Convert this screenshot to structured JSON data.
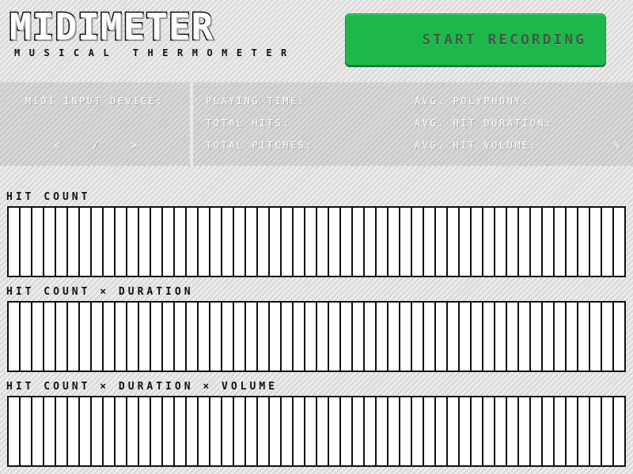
{
  "app": {
    "title": "MIDIMETER",
    "subtitle": "MUSICAL THERMOMETER"
  },
  "record_button": {
    "label": "START RECORDING",
    "color": "#1db84a"
  },
  "device": {
    "label": "MIDI INPUT DEVICE:",
    "prev_symbol": "<",
    "separator": "/",
    "next_symbol": ">"
  },
  "stats": {
    "playing_time_label": "PLAYING TIME:",
    "total_hits_label": "TOTAL HITS:",
    "total_pitches_label": "TOTAL PITCHES:",
    "avg_polyphony_label": "AVG. POLYPHONY:",
    "avg_hit_duration_label": "AVG. HIT DURATION:",
    "avg_hit_volume_label": "AVG. HIT VOLUME:",
    "percent_symbol": "%"
  },
  "graphs": [
    {
      "title": "HIT COUNT",
      "bar_count": 52,
      "values": []
    },
    {
      "title": "HIT COUNT × DURATION",
      "bar_count": 52,
      "values": []
    },
    {
      "title": "HIT COUNT × DURATION × VOLUME",
      "bar_count": 52,
      "values": []
    }
  ]
}
